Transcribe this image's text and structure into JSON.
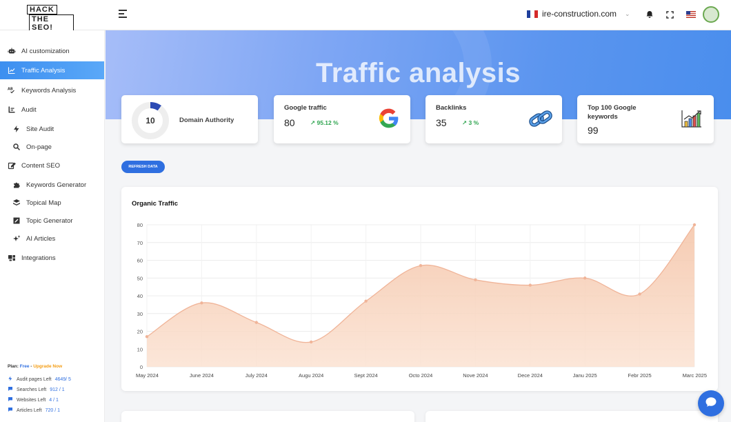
{
  "header": {
    "logo_line1": "HACK",
    "logo_line2": "THE SEO!",
    "domain": "ire-construction.com"
  },
  "sidebar": {
    "items": [
      {
        "label": "AI customization",
        "icon": "robot-icon"
      },
      {
        "label": "Traffic Analysis",
        "icon": "line-chart-icon",
        "active": true
      },
      {
        "label": "Keywords Analysis",
        "icon": "abc-check-icon"
      },
      {
        "label": "Audit",
        "icon": "bar-list-icon"
      },
      {
        "label": "Site Audit",
        "icon": "lightning-icon"
      },
      {
        "label": "On-page",
        "icon": "magnifier-icon"
      },
      {
        "label": "Content SEO",
        "icon": "edit-icon"
      },
      {
        "label": "Keywords Generator",
        "icon": "puzzle-icon"
      },
      {
        "label": "Topical Map",
        "icon": "layers-icon"
      },
      {
        "label": "Topic Generator",
        "icon": "note-icon"
      },
      {
        "label": "AI Articles",
        "icon": "sparkle-icon"
      },
      {
        "label": "Integrations",
        "icon": "integrations-icon"
      }
    ],
    "plan_prefix": "Plan:",
    "plan_name": "Free",
    "plan_sep": " - ",
    "upgrade": "Upgrade Now",
    "quotas": [
      {
        "label": "Audit pages Left",
        "value": "4649/ 5"
      },
      {
        "label": "Searches Left",
        "value": "912 / 1"
      },
      {
        "label": "Websites Left",
        "value": "4 / 1"
      },
      {
        "label": "Articles Left",
        "value": "720 / 1"
      }
    ]
  },
  "banner": {
    "title": "Traffic analysis"
  },
  "cards": {
    "domain_authority": {
      "label": "Domain Authority",
      "value": "10",
      "fraction": 0.1
    },
    "google_traffic": {
      "label": "Google traffic",
      "value": "80",
      "delta": "↗ 95.12 %"
    },
    "backlinks": {
      "label": "Backlinks",
      "value": "35",
      "delta": "↗ 3 %"
    },
    "top100": {
      "label": "Top 100 Google keywords",
      "value": "99"
    }
  },
  "refresh_label": "REFRESH DATA",
  "colors": {
    "accent": "#2f6fe0",
    "area_fill": "#f8d8c4",
    "area_line": "#f0b498",
    "positive": "#2ea44f"
  },
  "chart_data": {
    "type": "area",
    "title": "Organic Traffic",
    "categories": [
      "May 2024",
      "June 2024",
      "July 2024",
      "Augu 2024",
      "Sept 2024",
      "Octo 2024",
      "Nove 2024",
      "Dece 2024",
      "Janu 2025",
      "Febr 2025",
      "Marc 2025"
    ],
    "series": [
      {
        "values": [
          17,
          36,
          25,
          14,
          37,
          57,
          49,
          46,
          50,
          41,
          80
        ]
      }
    ],
    "ylim": [
      0,
      80
    ],
    "yticks": [
      0,
      10,
      20,
      30,
      40,
      50,
      60,
      70,
      80
    ],
    "grid": true,
    "smooth": true
  }
}
